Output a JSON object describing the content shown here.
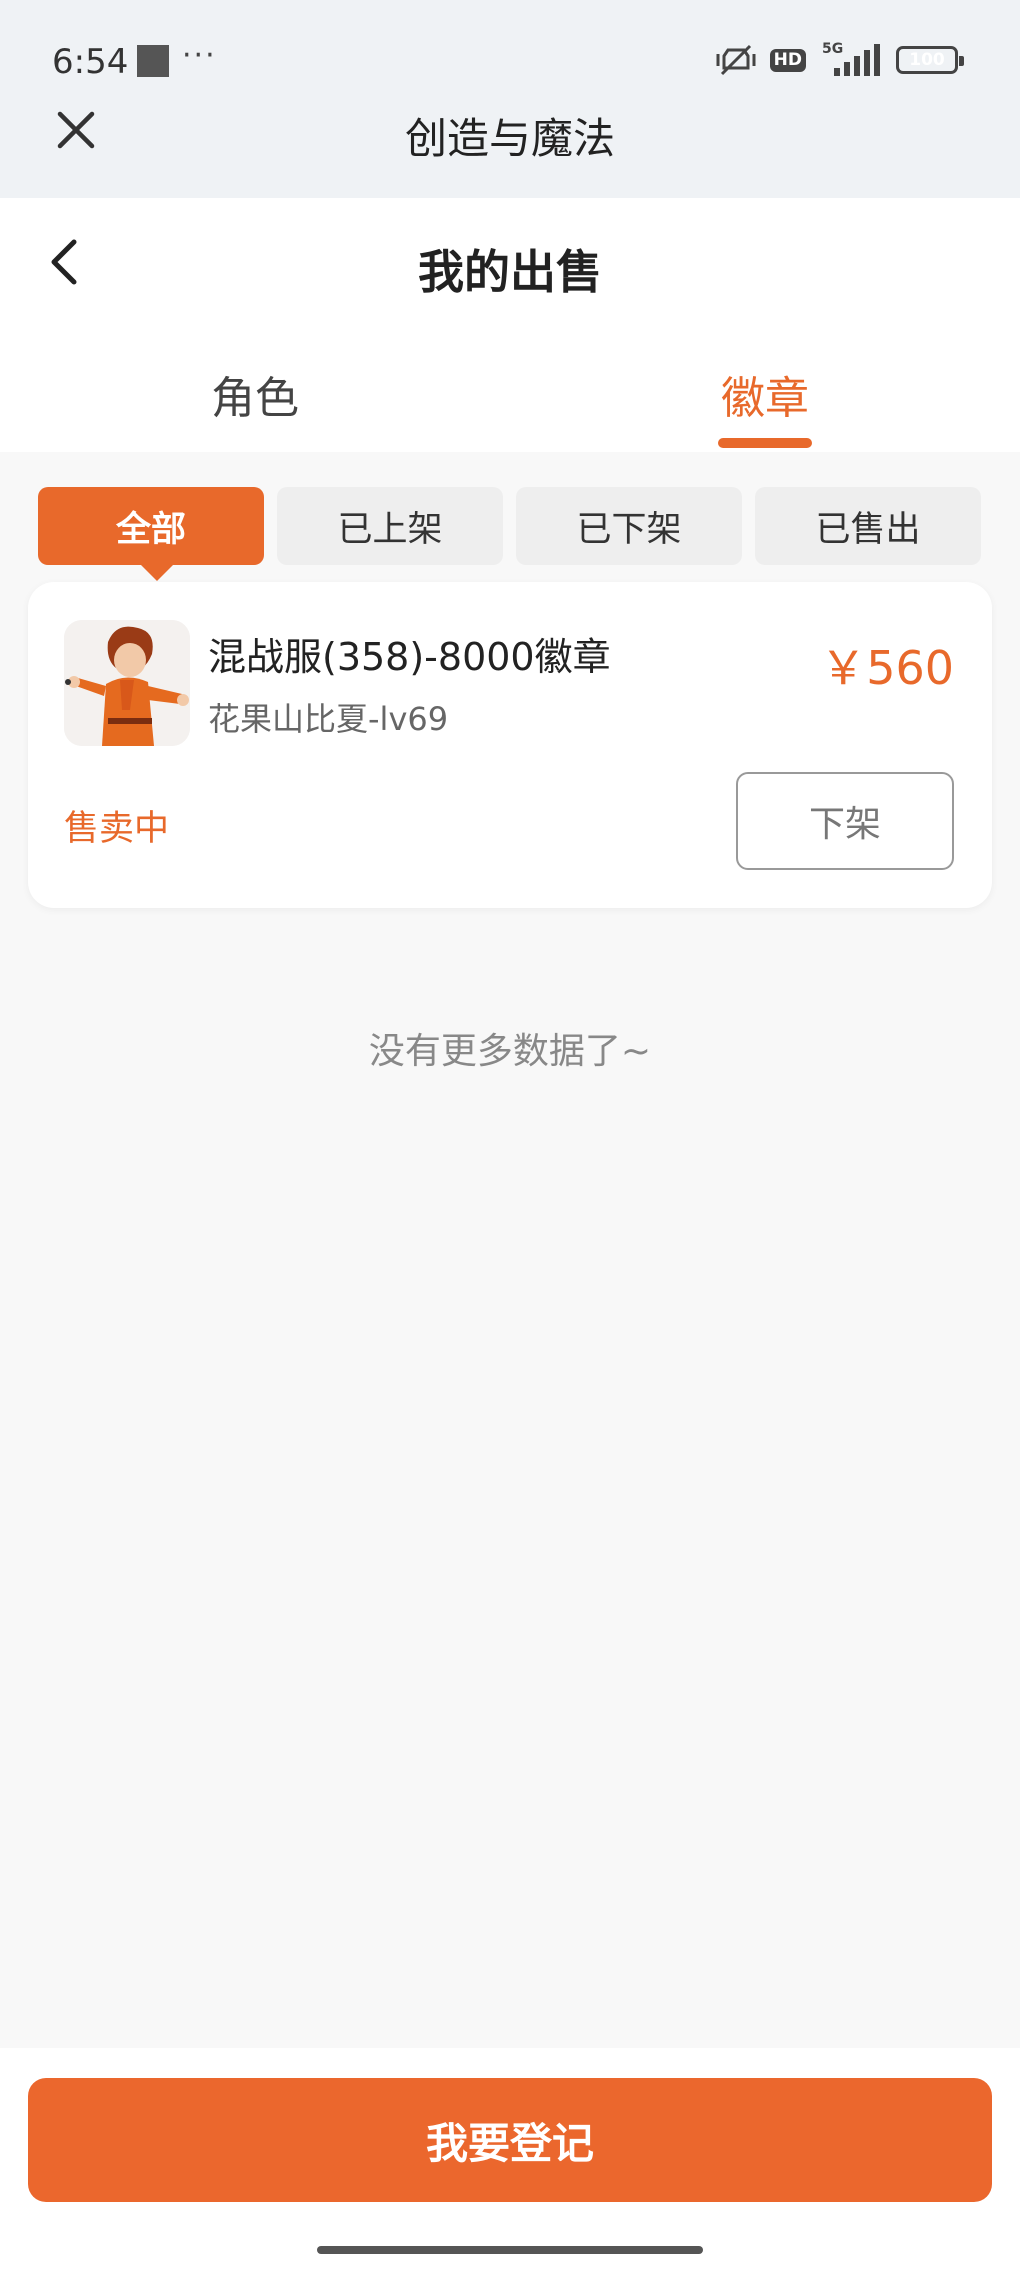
{
  "status_bar": {
    "time": "6:54",
    "dots": "···",
    "hd": "HD",
    "network": "5G",
    "battery": "100"
  },
  "app_bar": {
    "title": "创造与魔法"
  },
  "header": {
    "title": "我的出售",
    "tabs": [
      {
        "label": "角色",
        "active": false
      },
      {
        "label": "徽章",
        "active": true
      }
    ]
  },
  "filters": [
    {
      "label": "全部",
      "active": true
    },
    {
      "label": "已上架",
      "active": false
    },
    {
      "label": "已下架",
      "active": false
    },
    {
      "label": "已售出",
      "active": false
    }
  ],
  "listings": [
    {
      "name": "混战服(358)-8000徽章",
      "seller": "花果山比夏-lv69",
      "price": "￥560",
      "status": "售卖中",
      "action": "下架"
    }
  ],
  "no_more_text": "没有更多数据了~",
  "bottom": {
    "button_label": "我要登记"
  },
  "colors": {
    "accent": "#e8692b",
    "bg": "#f8f8f8",
    "topbar": "#eff2f5"
  }
}
